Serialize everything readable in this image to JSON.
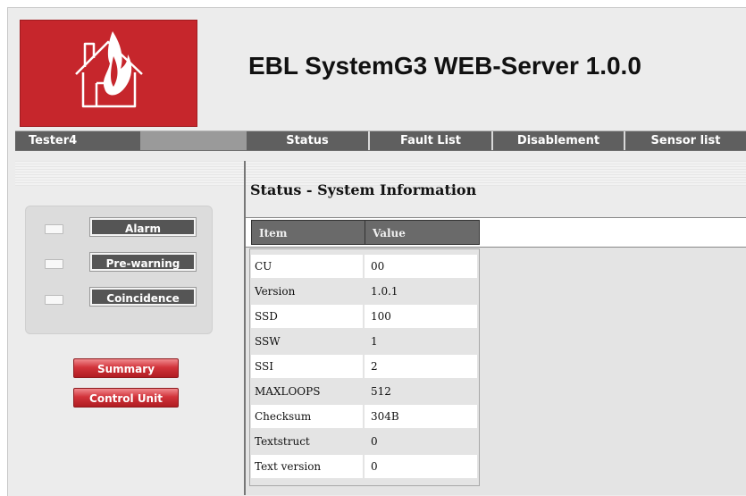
{
  "header": {
    "title": "EBL SystemG3 WEB-Server 1.0.0",
    "logo_icon": "house-fire-icon",
    "brand_color": "#c6262c"
  },
  "nav": {
    "user": "Tester4",
    "tabs": [
      {
        "label": "Status"
      },
      {
        "label": "Fault List"
      },
      {
        "label": "Disablement"
      },
      {
        "label": "Sensor list"
      }
    ]
  },
  "indicators": [
    {
      "label": "Alarm"
    },
    {
      "label": "Pre-warning"
    },
    {
      "label": "Coincidence"
    }
  ],
  "side_buttons": [
    {
      "label": "Summary"
    },
    {
      "label": "Control Unit"
    }
  ],
  "main": {
    "section_title": "Status - System Information",
    "table": {
      "headers": [
        "Item",
        "Value"
      ],
      "rows": [
        {
          "item": "CU",
          "value": "00"
        },
        {
          "item": "Version",
          "value": "1.0.1"
        },
        {
          "item": "SSD",
          "value": "100"
        },
        {
          "item": "SSW",
          "value": "1"
        },
        {
          "item": "SSI",
          "value": "2"
        },
        {
          "item": "MAXLOOPS",
          "value": "512"
        },
        {
          "item": "Checksum",
          "value": "304B"
        },
        {
          "item": "Textstruct",
          "value": "0"
        },
        {
          "item": "Text version",
          "value": "0"
        }
      ]
    }
  }
}
